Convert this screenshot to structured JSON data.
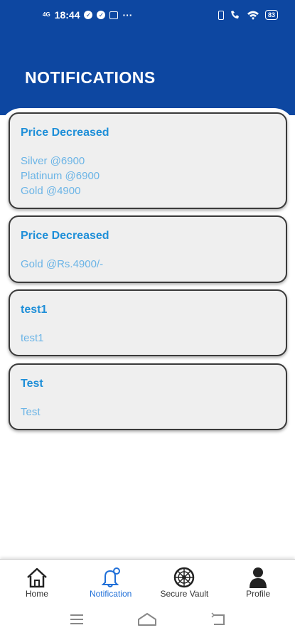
{
  "status_bar": {
    "time": "18:44",
    "signal_label": "4G",
    "battery": "83",
    "more": "···"
  },
  "header": {
    "title": "NOTIFICATIONS",
    "background_color": "#0d47a1"
  },
  "notifications": [
    {
      "title": "Price Decreased",
      "body_lines": [
        "Silver @6900",
        "Platinum @6900",
        "Gold @4900"
      ]
    },
    {
      "title": "Price Decreased",
      "body_lines": [
        "Gold @Rs.4900/-"
      ]
    },
    {
      "title": "test1",
      "body_lines": [
        "test1"
      ]
    },
    {
      "title": "Test",
      "body_lines": [
        "Test"
      ]
    }
  ],
  "bottom_nav": {
    "items": [
      {
        "label": "Home",
        "icon": "home-icon",
        "active": false
      },
      {
        "label": "Notification",
        "icon": "bell-icon",
        "active": true
      },
      {
        "label": "Secure Vault",
        "icon": "vault-icon",
        "active": false
      },
      {
        "label": "Profile",
        "icon": "person-icon",
        "active": false
      }
    ],
    "active_color": "#1f6fd8"
  },
  "system_nav": {
    "icons": [
      "menu-icon",
      "home-outline-icon",
      "back-icon"
    ]
  },
  "colors": {
    "card_title": "#1f8fd8",
    "card_body": "#6bb4e6",
    "card_bg": "#efefef"
  }
}
